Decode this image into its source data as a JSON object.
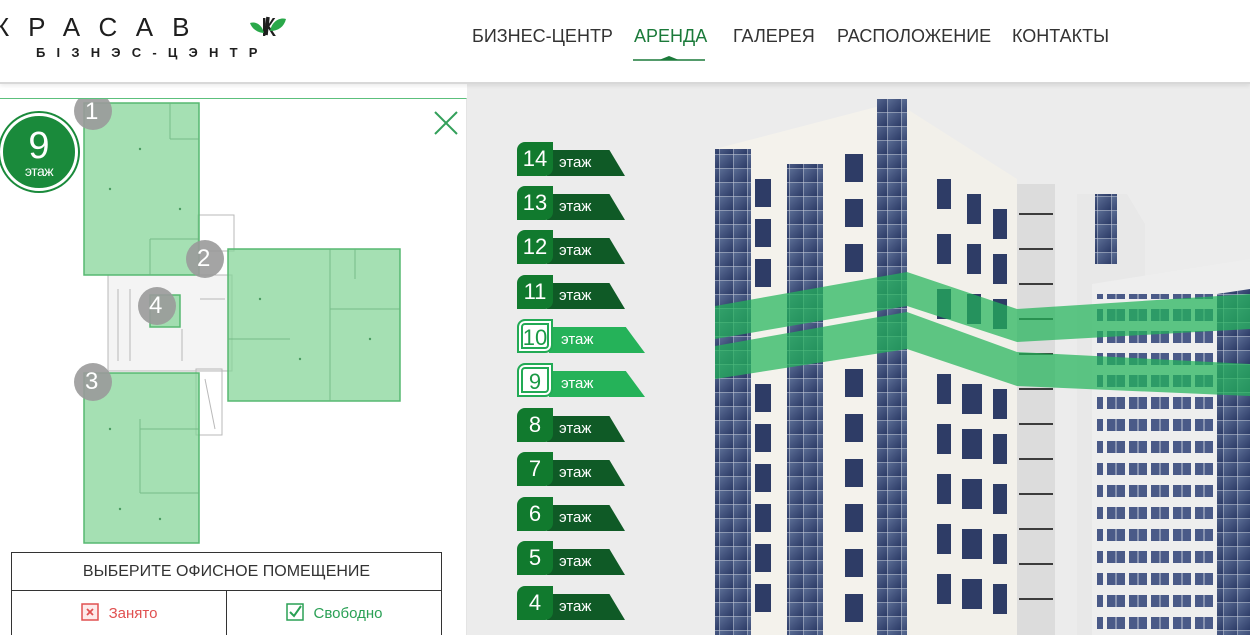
{
  "header": {
    "logo_main": "КРАСАВ  К",
    "logo_sub": "БІЗНЭС-ЦЭНТР",
    "nav": [
      {
        "label": "БИЗНЕС-ЦЕНТР",
        "active": false
      },
      {
        "label": "АРЕНДА",
        "active": true
      },
      {
        "label": "ГАЛЕРЕЯ",
        "active": false
      },
      {
        "label": "РАСПОЛОЖЕНИЕ",
        "active": false
      },
      {
        "label": "КОНТАКТЫ",
        "active": false
      }
    ]
  },
  "plan": {
    "floor_number": "9",
    "floor_label": "этаж",
    "room_markers": [
      "1",
      "2",
      "3",
      "4"
    ],
    "legend_title": "ВЫБЕРИТЕ ОФИСНОЕ ПОМЕЩЕНИЕ",
    "legend_busy": "Занято",
    "legend_free": "Свободно"
  },
  "building": {
    "floor_tag": "этаж",
    "floors": [
      {
        "num": "14",
        "highlighted": false
      },
      {
        "num": "13",
        "highlighted": false
      },
      {
        "num": "12",
        "highlighted": false
      },
      {
        "num": "11",
        "highlighted": false
      },
      {
        "num": "10",
        "highlighted": true
      },
      {
        "num": "9",
        "highlighted": true
      },
      {
        "num": "8",
        "highlighted": false
      },
      {
        "num": "7",
        "highlighted": false
      },
      {
        "num": "6",
        "highlighted": false
      },
      {
        "num": "5",
        "highlighted": false
      },
      {
        "num": "4",
        "highlighted": false
      }
    ]
  },
  "colors": {
    "brand_green": "#1a8a3b",
    "dark_green": "#0f5a26",
    "highlight_green": "#25b259",
    "busy_red": "#e05050"
  }
}
